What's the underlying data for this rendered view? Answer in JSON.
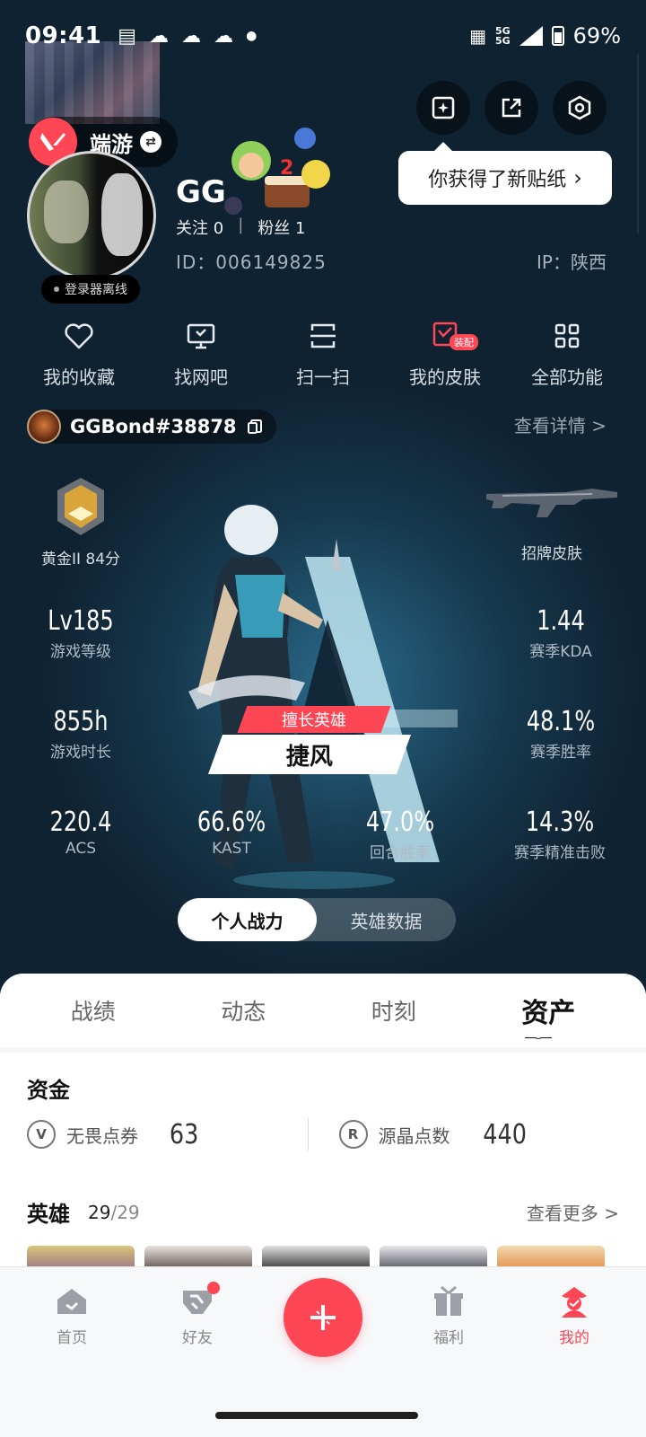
{
  "status_bar": {
    "time": "09:41",
    "net_top": "5G",
    "net_bottom": "5G",
    "battery": "69%",
    "battery_level": 0.69
  },
  "header": {
    "game_label": "端游",
    "sticker_tip": "你获得了新贴纸",
    "username": "GG",
    "follow_label": "关注",
    "follow_count": "0",
    "fans_label": "粉丝",
    "fans_count": "1",
    "separator": "|",
    "id_text": "ID：006149825",
    "ip_text": "IP：陕西",
    "offline_status": "登录器离线"
  },
  "functions": [
    {
      "label": "我的收藏",
      "icon": "heart-icon"
    },
    {
      "label": "找网吧",
      "icon": "monitor-icon"
    },
    {
      "label": "扫一扫",
      "icon": "scan-icon"
    },
    {
      "label": "我的皮肤",
      "icon": "skin-icon",
      "badge": "装配"
    },
    {
      "label": "全部功能",
      "icon": "grid-icon"
    }
  ],
  "profile": {
    "riot_id": "GGBond#38878",
    "view_detail": "查看详情 >",
    "rank": "黄金II 84分",
    "skin_label": "招牌皮肤",
    "best_hero_tag": "擅长英雄",
    "best_hero": "捷风"
  },
  "stats": {
    "level": {
      "value": "Lv185",
      "label": "游戏等级"
    },
    "kda": {
      "value": "1.44",
      "label": "赛季KDA"
    },
    "hours": {
      "value": "855h",
      "label": "游戏时长"
    },
    "winrate": {
      "value": "48.1%",
      "label": "赛季胜率"
    },
    "acs": {
      "value": "220.4",
      "label": "ACS"
    },
    "kast": {
      "value": "66.6%",
      "label": "KAST"
    },
    "round_winrate": {
      "value": "47.0%",
      "label": "回合胜率"
    },
    "headshot": {
      "value": "14.3%",
      "label": "赛季精准击败"
    }
  },
  "segments": {
    "personal": "个人战力",
    "hero": "英雄数据"
  },
  "tabs": [
    "战绩",
    "动态",
    "时刻",
    "资产"
  ],
  "funds": {
    "title": "资金",
    "vp_label": "无畏点券",
    "vp_value": "63",
    "rp_label": "源晶点数",
    "rp_value": "440"
  },
  "heroes": {
    "title": "英雄",
    "owned": "29",
    "sep": "/",
    "total": "29",
    "more": "查看更多 >"
  },
  "nav": {
    "home": "首页",
    "friends": "好友",
    "welfare": "福利",
    "mine": "我的"
  },
  "colors": {
    "accent": "#ff4655",
    "bg_dark": "#0f1c28",
    "panel": "#f4f5f7"
  }
}
